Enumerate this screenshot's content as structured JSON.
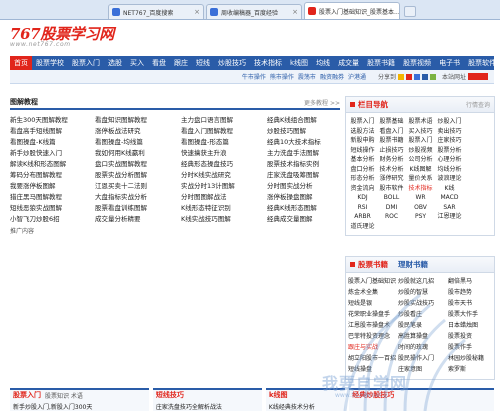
{
  "browser": {
    "tabs": [
      {
        "label": "NET767_百度搜索",
        "color": "#3a6fd8",
        "active": false
      },
      {
        "label": "周收编稿器_百度经验",
        "color": "#3a6fd8",
        "active": false
      },
      {
        "label": "股票入门基础知识_股票基本...",
        "color": "#e1251b",
        "active": true
      }
    ]
  },
  "site": {
    "logo": "767股票学习网",
    "url": "www.net767.com"
  },
  "nav": {
    "items": [
      "首页",
      "股票学校",
      "股票入门",
      "选股",
      "买入",
      "看盘",
      "跟庄",
      "短线",
      "炒股技巧",
      "技术指标",
      "k线图",
      "均线",
      "成交量",
      "股票书籍",
      "股票视频",
      "电子书",
      "股票软件"
    ]
  },
  "subnav": {
    "links": [
      "牛市操作",
      "熊市操作",
      "震荡市",
      "融资融券",
      "沪港通"
    ],
    "share_label": "分享到",
    "address_label": "本站网址"
  },
  "main": {
    "section_title": "图解教程",
    "more": "更多教程 >>",
    "items": [
      "新生300天图解教程",
      "看盘知识图解教程",
      "主力盘口语言图解",
      "经典K线组合图解",
      "看盘高手短线图解",
      "涨停板战法研究",
      "看盘入门图解教程",
      "炒股技巧图解",
      "看图操盘-K线篇",
      "看图操盘-均线篇",
      "看图操盘-形态篇",
      "经典10大技术指标",
      "新手炒股快速入门",
      "我如何用K线赢利",
      "快速擒获主升浪",
      "主力洗盘手法图解",
      "解读K线和形态图解",
      "盘口实战图解教程",
      "经典形态操盘技巧",
      "股票技术指标实例",
      "筹码分布图解教程",
      "股票实战分析图解",
      "分时K线实战研究",
      "庄家洗盘吸筹图解",
      "我要涨停板图解",
      "江恩买卖十二法则",
      "实战分时13计图解",
      "分时图实战分析",
      "猎庄黑马图解教程",
      "大盘指标实战分析",
      "分时图图解战法",
      "涨停板操盘图解",
      "短线恶狼实战图解",
      "股票看盘训练图解",
      "K线形态特征识别",
      "经典K线形态图解",
      "小智飞刀炒股6招",
      "成交量分析精要",
      "K线实战技巧图解",
      "经典成交量图解"
    ],
    "recommend": "推广内容"
  },
  "side": {
    "nav_title": "栏目导航",
    "nav_extra": "行情查询",
    "tags": [
      {
        "t": "股票入门",
        "hot": false
      },
      {
        "t": "股票基础",
        "hot": false
      },
      {
        "t": "股票术语",
        "hot": false
      },
      {
        "t": "炒股入门",
        "hot": false
      },
      {
        "t": "选股方法",
        "hot": false
      },
      {
        "t": "看盘入门",
        "hot": false
      },
      {
        "t": "买入技巧",
        "hot": false
      },
      {
        "t": "卖出技巧",
        "hot": false
      },
      {
        "t": "新股申购",
        "hot": false
      },
      {
        "t": "股票书籍",
        "hot": false
      },
      {
        "t": "股票入门",
        "hot": false
      },
      {
        "t": "庄家技巧",
        "hot": false
      },
      {
        "t": "短线操作",
        "hot": false
      },
      {
        "t": "止损技巧",
        "hot": false
      },
      {
        "t": "炒股视频",
        "hot": false
      },
      {
        "t": "股票分析",
        "hot": false
      },
      {
        "t": "基本分析",
        "hot": false
      },
      {
        "t": "财务分析",
        "hot": false
      },
      {
        "t": "公司分析",
        "hot": false
      },
      {
        "t": "心理分析",
        "hot": false
      },
      {
        "t": "盘口分析",
        "hot": false
      },
      {
        "t": "技术分析",
        "hot": false
      },
      {
        "t": "K线图解",
        "hot": false
      },
      {
        "t": "均线分析",
        "hot": false
      },
      {
        "t": "形态分析",
        "hot": false
      },
      {
        "t": "涨停研究",
        "hot": false
      },
      {
        "t": "量价关系",
        "hot": false
      },
      {
        "t": "波浪理论",
        "hot": false
      },
      {
        "t": "资金流向",
        "hot": false
      },
      {
        "t": "股市软件",
        "hot": false
      },
      {
        "t": "技术指标",
        "hot": true
      },
      {
        "t": "K线",
        "hot": false
      },
      {
        "t": "KDJ",
        "hot": false
      },
      {
        "t": "BOLL",
        "hot": false
      },
      {
        "t": "WR",
        "hot": false
      },
      {
        "t": "MACD",
        "hot": false
      },
      {
        "t": "RSI",
        "hot": false
      },
      {
        "t": "DMI",
        "hot": false
      },
      {
        "t": "OBV",
        "hot": false
      },
      {
        "t": "SAR",
        "hot": false
      },
      {
        "t": "ARBR",
        "hot": false
      },
      {
        "t": "ROC",
        "hot": false
      },
      {
        "t": "PSY",
        "hot": false
      },
      {
        "t": "江恩理论",
        "hot": false
      },
      {
        "t": "道氏理论",
        "hot": false
      }
    ],
    "books_title": "股票书籍",
    "books_title2": "理财书籍",
    "books": [
      {
        "t": "股票入门基础知识",
        "hot": false
      },
      {
        "t": "炒股就这几招",
        "hot": false
      },
      {
        "t": "翻倍黑马",
        "hot": false
      },
      {
        "t": "炼金术全集",
        "hot": false
      },
      {
        "t": "炒股的智慧",
        "hot": false
      },
      {
        "t": "股市趋势",
        "hot": false
      },
      {
        "t": "短线是银",
        "hot": false
      },
      {
        "t": "炒股实战技巧",
        "hot": false
      },
      {
        "t": "股市天书",
        "hot": false
      },
      {
        "t": "花荣职业操盘手",
        "hot": false
      },
      {
        "t": "炒股看庄",
        "hot": false
      },
      {
        "t": "股票大作手",
        "hot": false
      },
      {
        "t": "江恩股市操盘术",
        "hot": false
      },
      {
        "t": "股民笔录",
        "hot": false
      },
      {
        "t": "日本蜡烛图",
        "hot": false
      },
      {
        "t": "巴菲特投资理念",
        "hot": false
      },
      {
        "t": "高胜算操盘",
        "hot": false
      },
      {
        "t": "股票投资",
        "hot": false
      },
      {
        "t": "跟庄与实战",
        "hot": true
      },
      {
        "t": "时间的玫瑰",
        "hot": false
      },
      {
        "t": "股票作手",
        "hot": false
      },
      {
        "t": "胡立阳股市一百招",
        "hot": false
      },
      {
        "t": "股民操作入门",
        "hot": false
      },
      {
        "t": "林园炒股秘籍",
        "hot": false
      },
      {
        "t": "短线操盘",
        "hot": false
      },
      {
        "t": "庄家意图",
        "hot": false
      },
      {
        "t": "索罗斯",
        "hot": false
      }
    ]
  },
  "bottom": [
    {
      "title": "股票入门",
      "sub": "股票知识  术语",
      "line": "新手炒股入门,新股入门300天"
    },
    {
      "title": "短线技巧",
      "sub": "",
      "line": "庄家洗盘技巧全解析战法"
    },
    {
      "title": "k线图",
      "sub": "",
      "line": "K线经典技术分析"
    },
    {
      "title": "经典炒股技巧",
      "sub": "",
      "line": ""
    }
  ],
  "watermark": {
    "text": "我要自学网",
    "url": "www.51zxw.net"
  }
}
